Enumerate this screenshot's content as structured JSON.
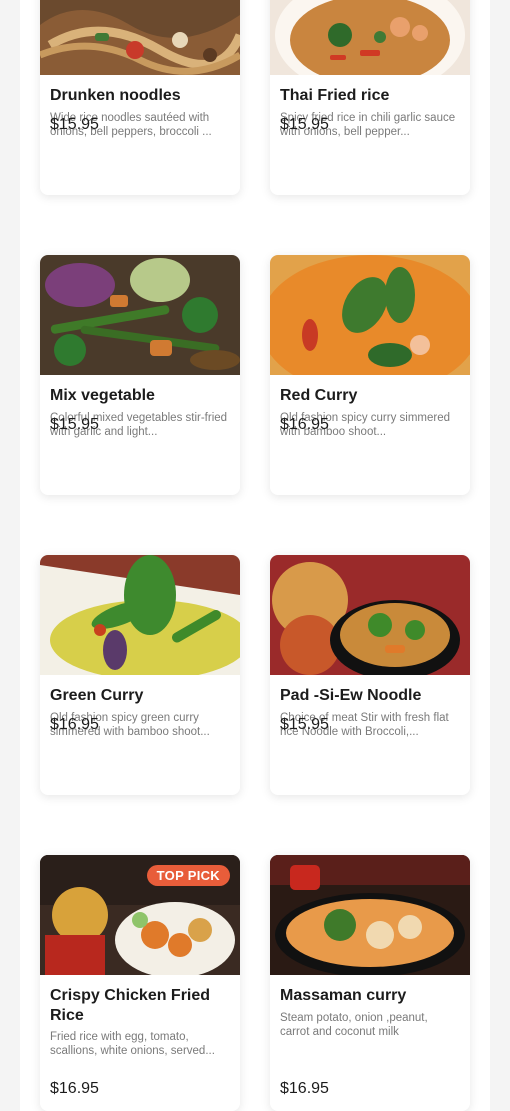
{
  "menu": {
    "items": [
      {
        "name": "Drunken noodles",
        "description": "Wide rice noodles sautéed with onions, bell peppers, broccoli ...",
        "price": "$15.95",
        "image": "drunken-noodles-photo"
      },
      {
        "name": "Thai Fried rice",
        "description": "Spicy fried rice in chili garlic sauce with onions, bell pepper...",
        "price": "$15.95",
        "image": "thai-fried-rice-photo"
      },
      {
        "name": "Mix vegetable",
        "description": "Colorful mixed vegetables stir-fried with garlic and light...",
        "price": "$15.95",
        "image": "mix-vegetable-photo"
      },
      {
        "name": "Red Curry",
        "description": "Old fashion spicy curry simmered with bamboo shoot...",
        "price": "$16.95",
        "image": "red-curry-photo"
      },
      {
        "name": "Green Curry",
        "description": "Old fashion spicy green curry simmered with bamboo shoot...",
        "price": "$16.95",
        "image": "green-curry-photo"
      },
      {
        "name": "Pad -Si-Ew Noodle",
        "description": "Choice of meat Stir with fresh flat rice Noodle with Broccoli,...",
        "price": "$15.95",
        "image": "pad-si-ew-photo"
      },
      {
        "name": "Crispy Chicken Fried Rice",
        "description": "Fried rice with egg, tomato, scallions, white onions, served...",
        "price": "$16.95",
        "image": "crispy-chicken-photo",
        "badge": "TOP PICK"
      },
      {
        "name": "Massaman curry",
        "description": "Steam potato, onion ,peanut, carrot and coconut milk",
        "price": "$16.95",
        "image": "massaman-curry-photo"
      }
    ]
  },
  "colors": {
    "page_bg": "#f4f4f4",
    "card_bg": "#ffffff",
    "badge": "#e85d3a",
    "title": "#1c1c1c",
    "desc": "#7a7a7a"
  }
}
